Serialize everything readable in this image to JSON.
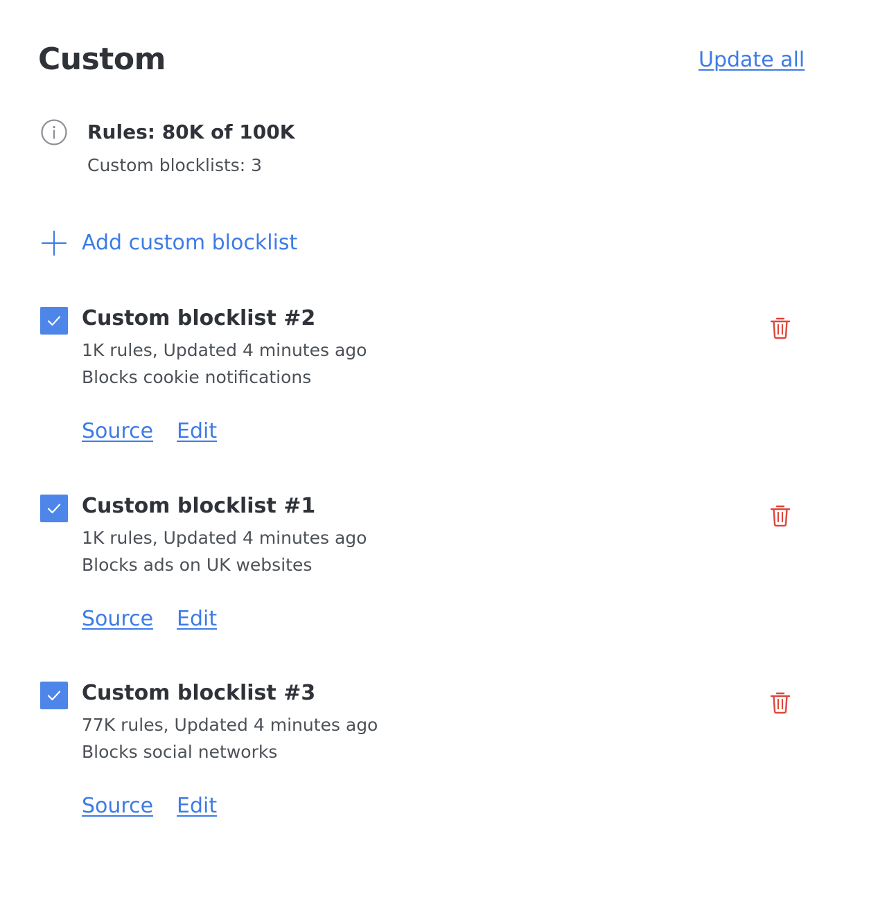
{
  "header": {
    "title": "Custom",
    "update_all_label": "Update all"
  },
  "summary": {
    "rules_label": "Rules: 80K of 100K",
    "blocklists_count_label": "Custom blocklists: 3",
    "icon": "info-icon"
  },
  "add_action": {
    "label": "Add custom blocklist",
    "icon": "plus-icon"
  },
  "colors": {
    "accent": "#3d7be6",
    "checkbox": "#4d86e8",
    "delete": "#e0463c",
    "text": "#2f3339",
    "muted": "#4c5157"
  },
  "blocklists": [
    {
      "checked": true,
      "title": "Custom blocklist #2",
      "meta": "1K rules, Updated 4 minutes ago",
      "description": "Blocks cookie notifications",
      "source_label": "Source",
      "edit_label": "Edit"
    },
    {
      "checked": true,
      "title": "Custom blocklist #1",
      "meta": "1K rules, Updated 4 minutes ago",
      "description": "Blocks ads on UK websites",
      "source_label": "Source",
      "edit_label": "Edit"
    },
    {
      "checked": true,
      "title": "Custom blocklist #3",
      "meta": "77K rules, Updated 4 minutes ago",
      "description": "Blocks social networks",
      "source_label": "Source",
      "edit_label": "Edit"
    }
  ]
}
